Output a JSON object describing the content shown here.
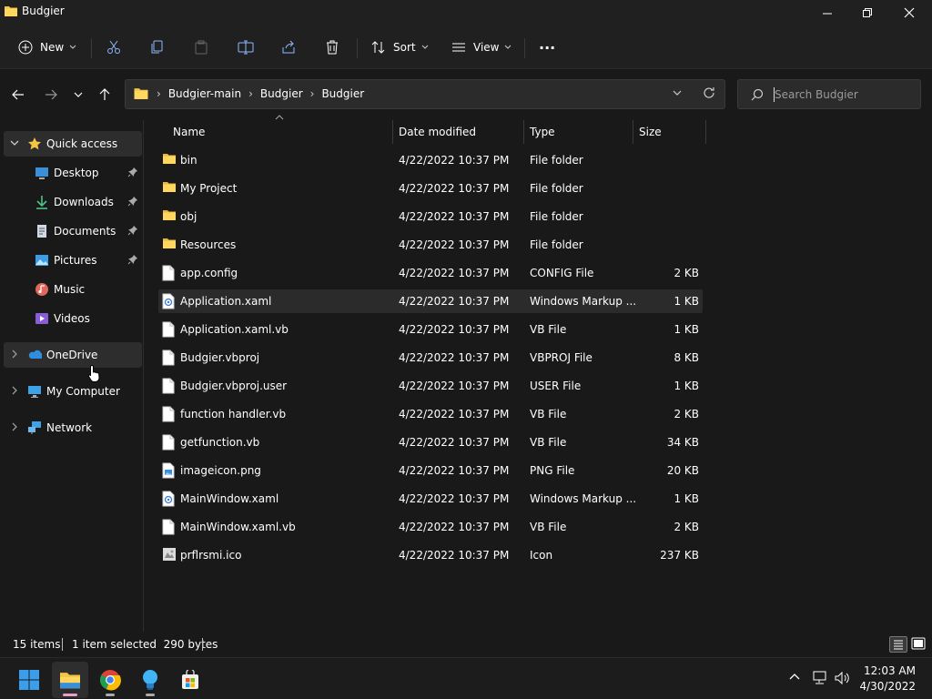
{
  "window": {
    "title": "Budgier"
  },
  "toolbar": {
    "new_label": "New",
    "sort_label": "Sort",
    "view_label": "View",
    "more_label": "..."
  },
  "address": {
    "crumbs": [
      "Budgier-main",
      "Budgier",
      "Budgier"
    ]
  },
  "search": {
    "placeholder": "Search Budgier"
  },
  "nav": {
    "quick_access": "Quick access",
    "items": [
      {
        "label": "Desktop",
        "icon": "desktop-icon",
        "pinned": true
      },
      {
        "label": "Downloads",
        "icon": "downloads-icon",
        "pinned": true
      },
      {
        "label": "Documents",
        "icon": "documents-icon",
        "pinned": true
      },
      {
        "label": "Pictures",
        "icon": "pictures-icon",
        "pinned": true
      },
      {
        "label": "Music",
        "icon": "music-icon",
        "pinned": false
      },
      {
        "label": "Videos",
        "icon": "videos-icon",
        "pinned": false
      }
    ],
    "onedrive": "OneDrive",
    "my_computer": "My Computer",
    "network": "Network"
  },
  "columns": {
    "name": "Name",
    "date": "Date modified",
    "type": "Type",
    "size": "Size"
  },
  "files": [
    {
      "name": "bin",
      "date": "4/22/2022 10:37 PM",
      "type": "File folder",
      "size": "",
      "icon": "folder-icon"
    },
    {
      "name": "My Project",
      "date": "4/22/2022 10:37 PM",
      "type": "File folder",
      "size": "",
      "icon": "folder-icon"
    },
    {
      "name": "obj",
      "date": "4/22/2022 10:37 PM",
      "type": "File folder",
      "size": "",
      "icon": "folder-icon"
    },
    {
      "name": "Resources",
      "date": "4/22/2022 10:37 PM",
      "type": "File folder",
      "size": "",
      "icon": "folder-icon"
    },
    {
      "name": "app.config",
      "date": "4/22/2022 10:37 PM",
      "type": "CONFIG File",
      "size": "2 KB",
      "icon": "file-icon"
    },
    {
      "name": "Application.xaml",
      "date": "4/22/2022 10:37 PM",
      "type": "Windows Markup ...",
      "size": "1 KB",
      "icon": "xaml-file-icon"
    },
    {
      "name": "Application.xaml.vb",
      "date": "4/22/2022 10:37 PM",
      "type": "VB File",
      "size": "1 KB",
      "icon": "file-icon"
    },
    {
      "name": "Budgier.vbproj",
      "date": "4/22/2022 10:37 PM",
      "type": "VBPROJ File",
      "size": "8 KB",
      "icon": "file-icon"
    },
    {
      "name": "Budgier.vbproj.user",
      "date": "4/22/2022 10:37 PM",
      "type": "USER File",
      "size": "1 KB",
      "icon": "file-icon"
    },
    {
      "name": "function handler.vb",
      "date": "4/22/2022 10:37 PM",
      "type": "VB File",
      "size": "2 KB",
      "icon": "file-icon"
    },
    {
      "name": "getfunction.vb",
      "date": "4/22/2022 10:37 PM",
      "type": "VB File",
      "size": "34 KB",
      "icon": "file-icon"
    },
    {
      "name": "imageicon.png",
      "date": "4/22/2022 10:37 PM",
      "type": "PNG File",
      "size": "20 KB",
      "icon": "image-file-icon"
    },
    {
      "name": "MainWindow.xaml",
      "date": "4/22/2022 10:37 PM",
      "type": "Windows Markup ...",
      "size": "1 KB",
      "icon": "xaml-file-icon"
    },
    {
      "name": "MainWindow.xaml.vb",
      "date": "4/22/2022 10:37 PM",
      "type": "VB File",
      "size": "2 KB",
      "icon": "file-icon"
    },
    {
      "name": "prflrsmi.ico",
      "date": "4/22/2022 10:37 PM",
      "type": "Icon",
      "size": "237 KB",
      "icon": "ico-file-icon"
    }
  ],
  "selected_row": "Application.xaml",
  "status": {
    "count": "15 items",
    "selection": "1 item selected  290 bytes"
  },
  "taskbar": {
    "time": "12:03 AM",
    "date": "4/30/2022"
  },
  "colors": {
    "background": "#191919",
    "chrome": "#202020",
    "folder": "#f4c542",
    "selection": "#2b2b2b"
  }
}
